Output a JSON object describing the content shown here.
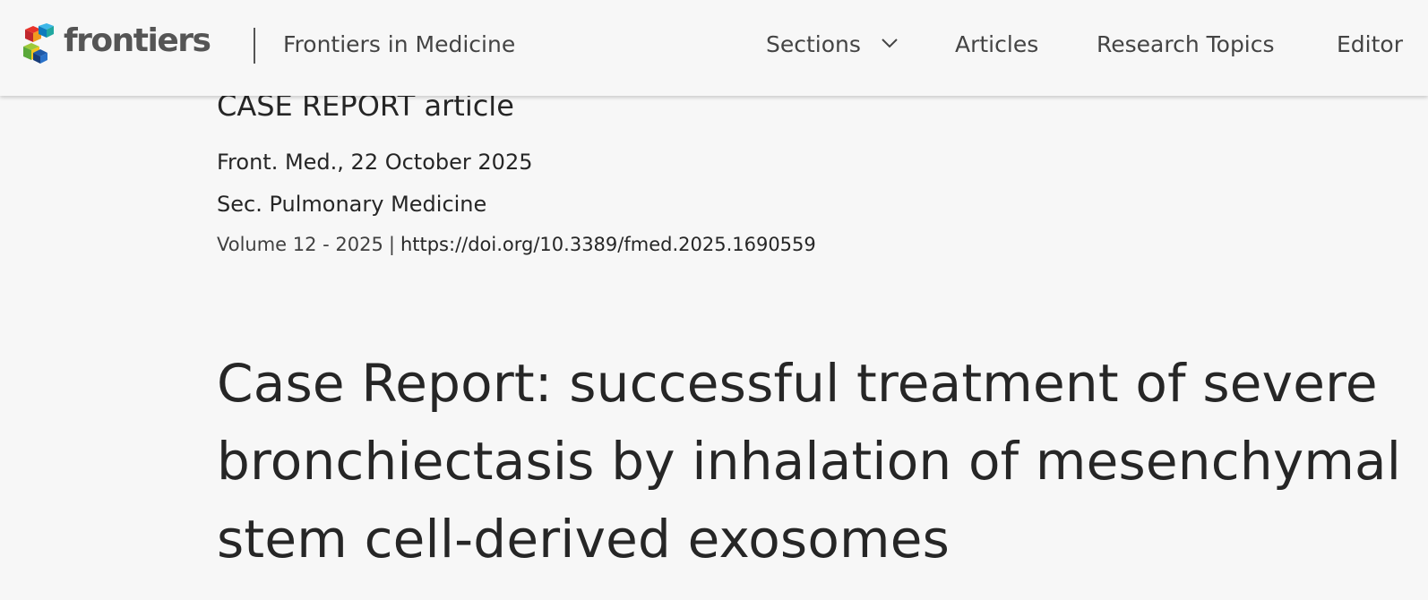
{
  "header": {
    "logo_text": "frontiers",
    "journal_name": "Frontiers in Medicine",
    "nav": {
      "sections": "Sections",
      "articles": "Articles",
      "research_topics": "Research Topics",
      "editors": "Editor"
    }
  },
  "article": {
    "type": "CASE REPORT article",
    "journal_date": "Front. Med., 22 October 2025",
    "section": "Sec. Pulmonary Medicine",
    "volume": "Volume 12 - 2025",
    "separator": "|",
    "doi": "https://doi.org/10.3389/fmed.2025.1690559",
    "title": "Case Report: successful treatment of severe bronchiectasis by inhalation of mesenchymal stem cell-derived exosomes"
  },
  "colors": {
    "background": "#f7f7f7",
    "text": "#262626",
    "logo_gray": "#555555"
  }
}
